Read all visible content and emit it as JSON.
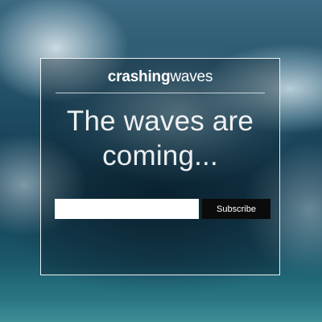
{
  "brand": {
    "logo_bold": "crashing",
    "logo_light": "waves"
  },
  "hero": {
    "headline_line1": "The waves are",
    "headline_line2": "coming..."
  },
  "signup": {
    "email_value": "",
    "email_placeholder": "",
    "subscribe_label": "Subscribe"
  }
}
